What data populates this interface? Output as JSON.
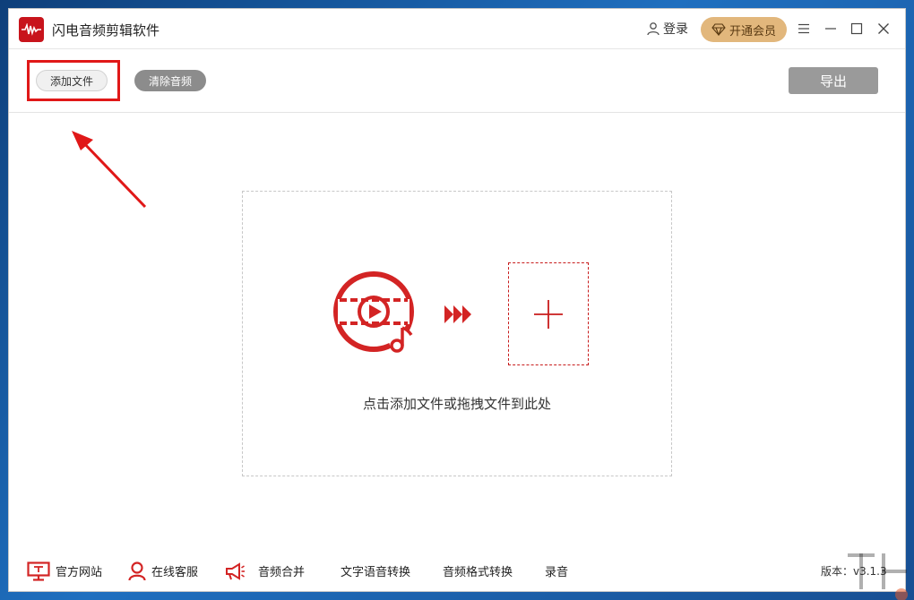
{
  "window": {
    "title": "闪电音频剪辑软件",
    "accent_color": "#c8141c"
  },
  "titlebar": {
    "login_label": "登录",
    "vip_label": "开通会员",
    "controls": [
      "menu-icon",
      "minimize-icon",
      "maximize-icon",
      "close-icon"
    ]
  },
  "toolbar": {
    "add_file_label": "添加文件",
    "clear_audio_label": "清除音频",
    "export_label": "导出"
  },
  "drop_zone": {
    "hint": "点击添加文件或拖拽文件到此处"
  },
  "footer": {
    "items": [
      {
        "label": "官方网站",
        "icon": "monitor-icon"
      },
      {
        "label": "在线客服",
        "icon": "person-icon"
      },
      {
        "label": "音频合并",
        "icon": "megaphone-icon"
      },
      {
        "label": "文字语音转换"
      },
      {
        "label": "音频格式转换"
      },
      {
        "label": "录音"
      }
    ],
    "version": "版本：v3.1.3"
  },
  "colors": {
    "highlight": "#e01818",
    "vip_gold": "#e2b77c",
    "export_gray": "#9a9a9a"
  }
}
